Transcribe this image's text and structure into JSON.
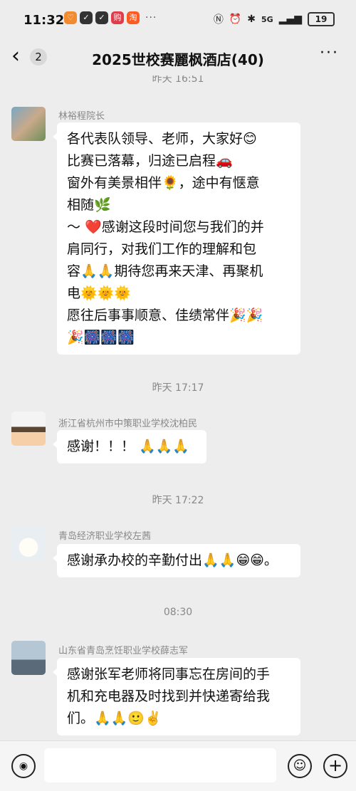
{
  "status_bar": {
    "time": "11:32",
    "network": "5G",
    "battery": "19",
    "apps": [
      "♡",
      "✓",
      "✓",
      "购",
      "淘"
    ],
    "more": "···"
  },
  "header": {
    "back_icon": "‹",
    "unread_count": "2",
    "title": "2025世校赛麗枫酒店(40)",
    "more_icon": "···"
  },
  "messages": [
    {
      "type": "timestamp",
      "text": "昨天 16:51"
    },
    {
      "sender": "林裕程院长",
      "lines": [
        "各代表队领导、老师，大家好😊",
        "比赛已落幕，归途已启程🚗",
        "窗外有美景相伴🌻，途中有惬意",
        "相随🌿",
        "～ ❤️感谢这段时间您与我们的并",
        "肩同行，对我们工作的理解和包",
        "容🙏🙏期待您再来天津、再聚机",
        "电🌞🌞🌞",
        "愿往后事事顺意、佳绩常伴🎉🎉",
        "🎉🎆🎆🎆"
      ]
    },
    {
      "type": "timestamp",
      "text": "昨天 17:17"
    },
    {
      "sender": "浙江省杭州市中策职业学校沈柏民",
      "lines": [
        "感谢！！！ 🙏🙏🙏"
      ]
    },
    {
      "type": "timestamp",
      "text": "昨天 17:22"
    },
    {
      "sender": "青岛经济职业学校左茜",
      "lines": [
        "感谢承办校的辛勤付出🙏🙏😁😁。"
      ]
    },
    {
      "type": "timestamp",
      "text": "08:30"
    },
    {
      "sender": "山东省青岛烹饪职业学校薛志军",
      "lines": [
        "感谢张军老师将同事忘在房间的手",
        "机和充电器及时找到并快递寄给我",
        "们。🙏🙏🙂✌️"
      ]
    }
  ],
  "input_bar": {
    "voice_icon": "◉",
    "emoji_icon": "☺",
    "plus_icon": "+"
  },
  "colors": {
    "background": "#ededed",
    "bubble": "#ffffff",
    "timestamp": "#888888"
  }
}
